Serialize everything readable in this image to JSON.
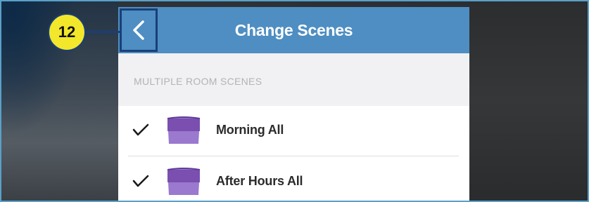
{
  "callout": {
    "number": "12"
  },
  "header": {
    "title": "Change Scenes",
    "back_icon": "chevron-left-icon"
  },
  "section": {
    "label": "MULTIPLE ROOM SCENES"
  },
  "scenes": [
    {
      "label": "Morning All",
      "checked": true,
      "icon": "scene-shade-icon"
    },
    {
      "label": "After Hours All",
      "checked": true,
      "icon": "scene-shade-icon"
    }
  ],
  "colors": {
    "header_bg": "#4e8ec2",
    "callout_bg": "#f2e72a",
    "callout_border": "#1a3f78",
    "scene_icon_purple": "#7a4fb0"
  }
}
